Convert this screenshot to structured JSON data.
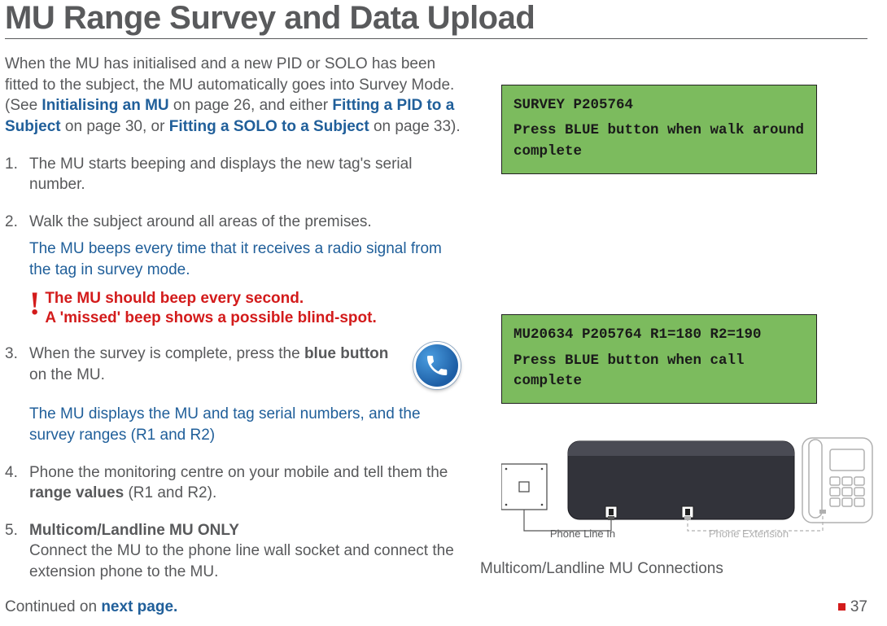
{
  "title": "MU Range Survey and Data Upload",
  "intro": {
    "p1a": "When the MU has initialised  and a new PID or SOLO has been fitted to the subject, the MU automatically goes into Survey Mode. (See ",
    "ref1": "Initialising an MU",
    "p1b": " on page 26, and either ",
    "ref2": "Fitting a PID to a Subject",
    "p1c": " on page 30, or ",
    "ref3": "Fitting a SOLO to a Subject",
    "p1d": " on page 33)."
  },
  "steps": {
    "s1": {
      "num": "1.",
      "text": "The MU starts beeping and displays the new tag's serial number."
    },
    "s2": {
      "num": "2.",
      "text": "Walk the subject around all areas of the premises.",
      "note": "The MU beeps every time that it receives a radio signal from the tag in survey mode.",
      "warn1": "The MU should beep every second.",
      "warn2": "A 'missed' beep shows a possible blind-spot."
    },
    "s3": {
      "num": "3.",
      "textA": "When the survey is complete, press the ",
      "bold": "blue button",
      "textB": " on the MU.",
      "note": "The MU displays the MU and tag serial numbers, and the survey ranges (R1 and R2)"
    },
    "s4": {
      "num": "4.",
      "textA": "Phone the monitoring centre on your mobile and tell them the ",
      "bold": "range values",
      "textB": " (R1 and R2)."
    },
    "s5": {
      "num": "5.",
      "bold": "Multicom/Landline MU ONLY",
      "text": "Connect the MU to the phone line wall socket and connect the extension phone to the MU."
    }
  },
  "lcd1": {
    "line1": "SURVEY P205764",
    "line2": "Press BLUE button when walk around complete"
  },
  "lcd2": {
    "line1": "MU20634 P205764 R1=180 R2=190",
    "line2": "Press BLUE button when call complete"
  },
  "diagram": {
    "label1": "Phone Line In",
    "label2": "Phone Extension",
    "caption": "Multicom/Landline MU Connections"
  },
  "footer": {
    "contA": "Continued on ",
    "contB": "next page.",
    "page": "37"
  }
}
